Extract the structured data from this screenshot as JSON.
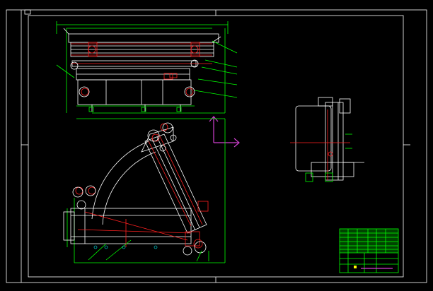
{
  "drawing": {
    "background": "#000000",
    "line_color": "#ffffff",
    "dimension_color": "#00ff00",
    "part_color": "#ff2020",
    "centerline_color": "#ff2020",
    "ucs_color": "#d040d0"
  },
  "views": [
    {
      "name": "front-view"
    },
    {
      "name": "plan-view"
    },
    {
      "name": "side-view"
    }
  ],
  "title_block": {
    "color": "#00ff00",
    "rows": 8
  }
}
